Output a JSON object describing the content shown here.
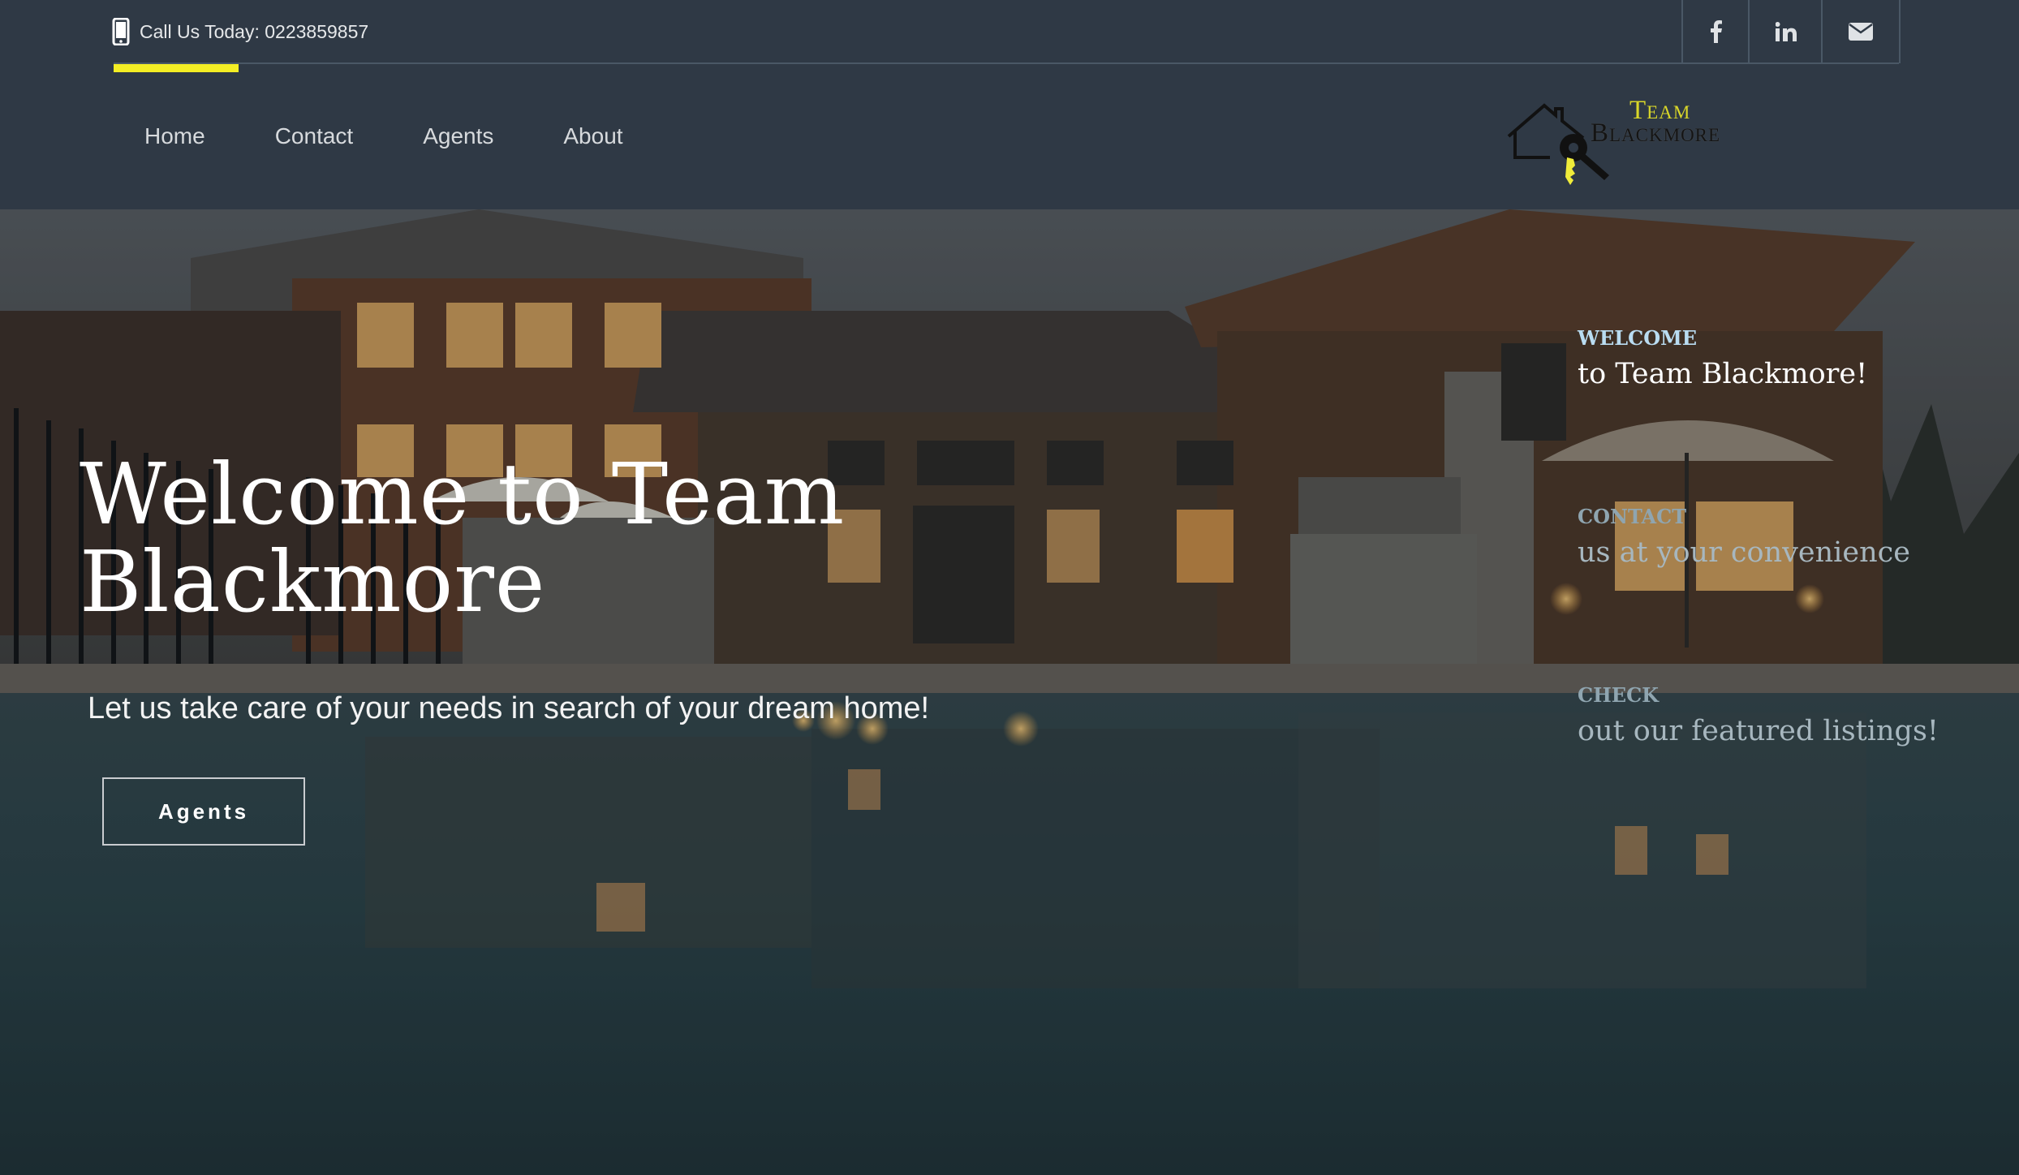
{
  "topbar": {
    "phone_text": "Call Us Today: 0223859857",
    "social": [
      "facebook-icon",
      "linkedin-icon",
      "envelope-icon"
    ],
    "accent_color": "#f4ee24"
  },
  "nav": {
    "items": [
      {
        "label": "Home"
      },
      {
        "label": "Contact"
      },
      {
        "label": "Agents"
      },
      {
        "label": "About"
      }
    ]
  },
  "logo": {
    "line1": "Team",
    "line2": "Blackmore",
    "colors": {
      "team": "#d9d629",
      "key": "#f0ec3a"
    }
  },
  "hero": {
    "title": "Welcome to Team Blackmore",
    "subtitle": "Let us take care of your needs in search of your dream home!",
    "button_label": "Agents",
    "slides": [
      {
        "kicker": "WELCOME",
        "text": "to Team Blackmore!"
      },
      {
        "kicker": "CONTACT",
        "text": "us at your convenience"
      },
      {
        "kicker": "CHECK",
        "text": "out our featured listings!"
      }
    ]
  },
  "colors": {
    "header_bg": "#2f3945"
  }
}
